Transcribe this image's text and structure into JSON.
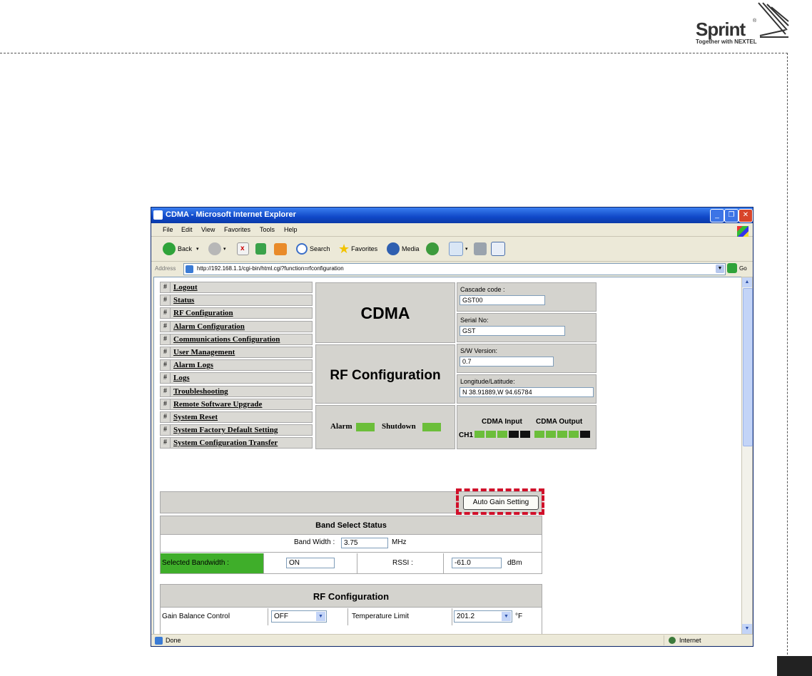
{
  "brand": {
    "name": "Sprint",
    "tagline": "Together with NEXTEL",
    "registered": "®"
  },
  "window": {
    "title": "CDMA - Microsoft Internet Explorer",
    "min": "_",
    "max": "❐",
    "close": "✕"
  },
  "menu": [
    "File",
    "Edit",
    "View",
    "Favorites",
    "Tools",
    "Help"
  ],
  "toolbar": {
    "back": "Back",
    "search": "Search",
    "favorites": "Favorites",
    "media": "Media"
  },
  "address": {
    "label": "Address",
    "url": "http://192.168.1.1/cgi-bin/html.cgi?function=rfconfiguration",
    "go": "Go"
  },
  "nav": [
    {
      "hash": "#",
      "label": "Logout"
    },
    {
      "hash": "#",
      "label": "Status"
    },
    {
      "hash": "#",
      "label": "RF Configuration"
    },
    {
      "hash": "#",
      "label": "Alarm Configuration"
    },
    {
      "hash": "#",
      "label": "Communications Configuration"
    },
    {
      "hash": "#",
      "label": "User Management"
    },
    {
      "hash": "#",
      "label": "Alarm Logs"
    },
    {
      "hash": "#",
      "label": "Logs"
    },
    {
      "hash": "#",
      "label": "Troubleshooting"
    },
    {
      "hash": "#",
      "label": "Remote Software Upgrade"
    },
    {
      "hash": "#",
      "label": "System Reset"
    },
    {
      "hash": "#",
      "label": "System Factory Default Setting"
    },
    {
      "hash": "#",
      "label": "System Configuration Transfer"
    }
  ],
  "header": {
    "product": "CDMA",
    "page": "RF Configuration",
    "cascade_label": "Cascade code :",
    "cascade_value": "GST00",
    "serial_label": "Serial No:",
    "serial_value": "GST",
    "sw_label": "S/W Version:",
    "sw_value": "0.7",
    "lonlat_label": "Longitude/Latitude:",
    "lonlat_value": "N 38.91889,W 94.65784",
    "alarm_label": "Alarm",
    "shutdown_label": "Shutdown",
    "input_label": "CDMA Input",
    "output_label": "CDMA Output",
    "channel": "CH1",
    "input_leds": [
      "on",
      "on",
      "on",
      "off",
      "off"
    ],
    "output_leds": [
      "on",
      "on",
      "on",
      "on",
      "off"
    ]
  },
  "auto_gain": {
    "button": "Auto Gain Setting"
  },
  "band": {
    "title": "Band Select Status",
    "bw_label": "Band Width :",
    "bw_value": "3.75",
    "bw_unit": "MHz",
    "selected_label": "Selected Bandwidth :",
    "selected_value": "ON",
    "rssi_label": "RSSI :",
    "rssi_value": "-61.0",
    "rssi_unit": "dBm"
  },
  "rf": {
    "title": "RF Configuration",
    "gain_label": "Gain Balance Control",
    "gain_value": "OFF",
    "temp_label": "Temperature Limit",
    "temp_value": "201.2",
    "temp_unit": "°F"
  },
  "status": {
    "text": "Done",
    "zone": "Internet"
  },
  "colors": {
    "led_on": "#6bbe3a",
    "led_off": "#111111",
    "highlight": "#d0102a",
    "selected_bg": "#3fae2a"
  }
}
